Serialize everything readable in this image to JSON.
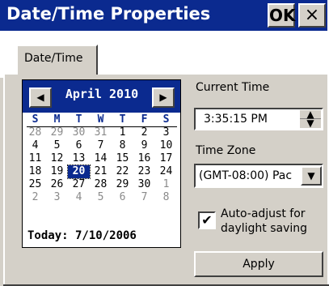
{
  "window": {
    "title": "Date/Time Properties",
    "ok_label": "OK",
    "close_label": "×"
  },
  "tabs": [
    {
      "label": "Date/Time"
    }
  ],
  "calendar": {
    "month_label": "April 2010",
    "prev_glyph": "◀",
    "next_glyph": "▶",
    "weekdays": [
      "S",
      "M",
      "T",
      "W",
      "T",
      "F",
      "S"
    ],
    "weeks": [
      [
        "28",
        "29",
        "30",
        "31",
        "1",
        "2",
        "3"
      ],
      [
        "4",
        "5",
        "6",
        "7",
        "8",
        "9",
        "10"
      ],
      [
        "11",
        "12",
        "13",
        "14",
        "15",
        "16",
        "17"
      ],
      [
        "18",
        "19",
        "20",
        "21",
        "22",
        "23",
        "24"
      ],
      [
        "25",
        "26",
        "27",
        "28",
        "29",
        "30",
        "1"
      ],
      [
        "2",
        "3",
        "4",
        "5",
        "6",
        "7",
        "8"
      ]
    ],
    "other_month_cells": [
      [
        0,
        0
      ],
      [
        0,
        1
      ],
      [
        0,
        2
      ],
      [
        0,
        3
      ],
      [
        4,
        6
      ],
      [
        5,
        0
      ],
      [
        5,
        1
      ],
      [
        5,
        2
      ],
      [
        5,
        3
      ],
      [
        5,
        4
      ],
      [
        5,
        5
      ],
      [
        5,
        6
      ]
    ],
    "selected_day": "20",
    "today_text": "Today: 7/10/2006"
  },
  "current_time": {
    "label": "Current Time",
    "value": "3:35:15 PM",
    "up_glyph": "▲",
    "down_glyph": "▼"
  },
  "time_zone": {
    "label": "Time Zone",
    "value": "(GMT-08:00) Pac",
    "dropdown_glyph": "▼"
  },
  "auto_adjust": {
    "checked": true,
    "check_glyph": "✔",
    "label_line1": "Auto-adjust for",
    "label_line2": "daylight saving"
  },
  "apply_label": "Apply",
  "colors": {
    "title_bar": "#0b2a8f",
    "face": "#d4d0c8",
    "selection": "#0b2a8f"
  }
}
